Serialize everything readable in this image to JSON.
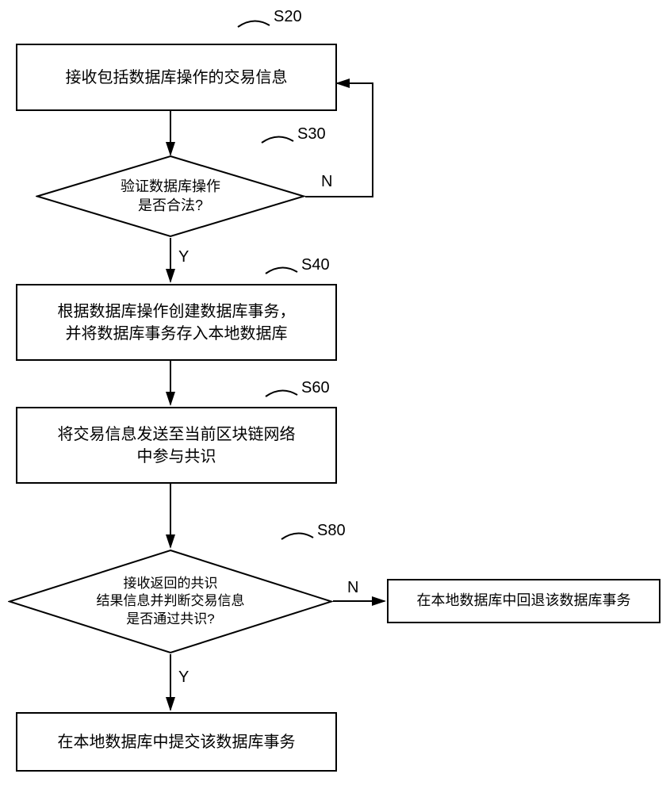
{
  "steps": {
    "s20": {
      "label": "S20",
      "text": "接收包括数据库操作的交易信息"
    },
    "s30": {
      "label": "S30",
      "text": "验证数据库操作\n是否合法?"
    },
    "s40": {
      "label": "S40",
      "text": "根据数据库操作创建数据库事务，\n并将数据库事务存入本地数据库"
    },
    "s60": {
      "label": "S60",
      "text": "将交易信息发送至当前区块链网络\n中参与共识"
    },
    "s80": {
      "label": "S80",
      "text": "接收返回的共识\n结果信息并判断交易信息\n是否通过共识?"
    },
    "rollback": {
      "text": "在本地数据库中回退该数据库事务"
    },
    "commit": {
      "text": "在本地数据库中提交该数据库事务"
    }
  },
  "labels": {
    "yes": "Y",
    "no": "N"
  }
}
